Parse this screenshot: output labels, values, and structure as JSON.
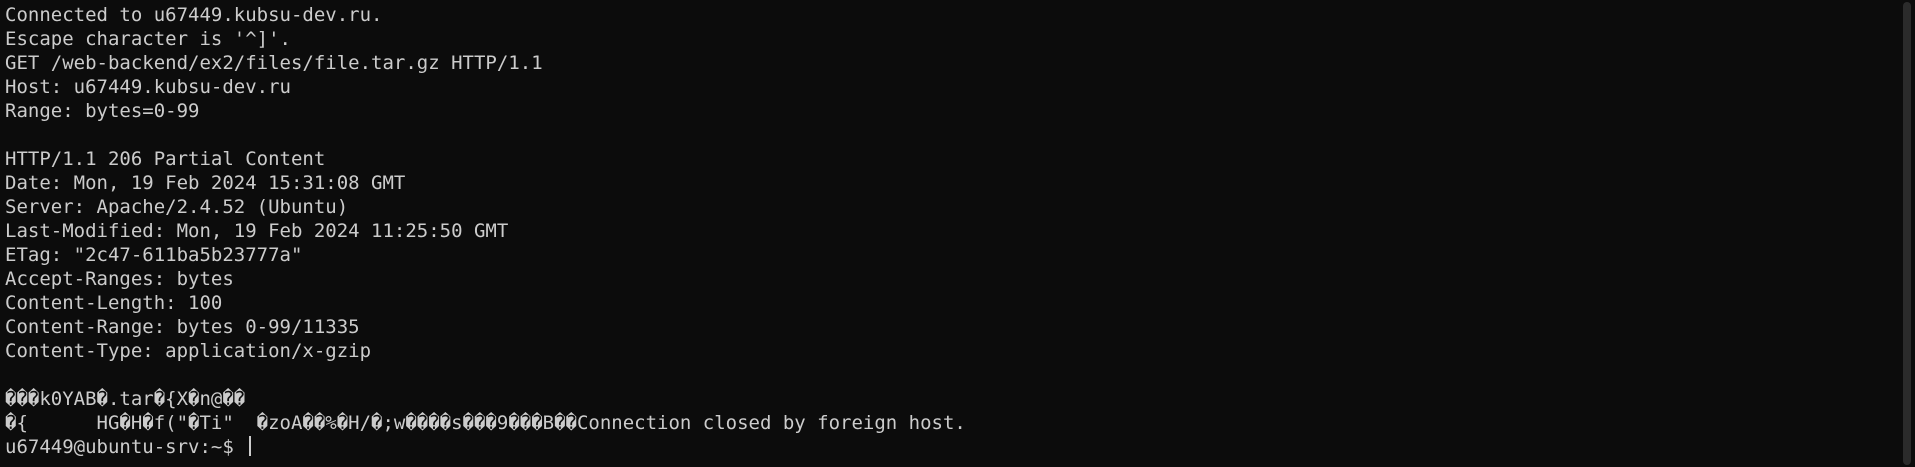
{
  "terminal": {
    "lines": [
      "Connected to u67449.kubsu-dev.ru.",
      "Escape character is '^]'.",
      "GET /web-backend/ex2/files/file.tar.gz HTTP/1.1",
      "Host: u67449.kubsu-dev.ru",
      "Range: bytes=0-99",
      "",
      "HTTP/1.1 206 Partial Content",
      "Date: Mon, 19 Feb 2024 15:31:08 GMT",
      "Server: Apache/2.4.52 (Ubuntu)",
      "Last-Modified: Mon, 19 Feb 2024 11:25:50 GMT",
      "ETag: \"2c47-611ba5b23777a\"",
      "Accept-Ranges: bytes",
      "Content-Length: 100",
      "Content-Range: bytes 0-99/11335",
      "Content-Type: application/x-gzip",
      "",
      "���k0YAB�.tar�{X�n@��",
      "�{      HG�H�f(\"�Ti\"  �zoA��%�H/�;w����s���9���B��Connection closed by foreign host."
    ],
    "prompt": "u67449@ubuntu-srv:~$ "
  },
  "colors": {
    "background": "#0c0c0c",
    "foreground": "#cccccc"
  }
}
